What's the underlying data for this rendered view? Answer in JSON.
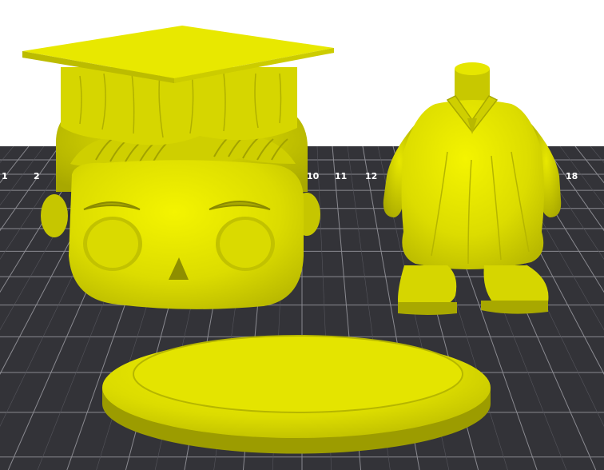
{
  "viewport": {
    "background_color": "#ffffff",
    "bed_color": "#333338",
    "grid_color": "#8a8a90",
    "model_color": "#e6e600"
  },
  "bed": {
    "labels": [
      "1",
      "2",
      "10",
      "11",
      "12",
      "18"
    ]
  },
  "models": [
    {
      "name": "graduation-head"
    },
    {
      "name": "graduation-body"
    },
    {
      "name": "base-plate"
    }
  ]
}
